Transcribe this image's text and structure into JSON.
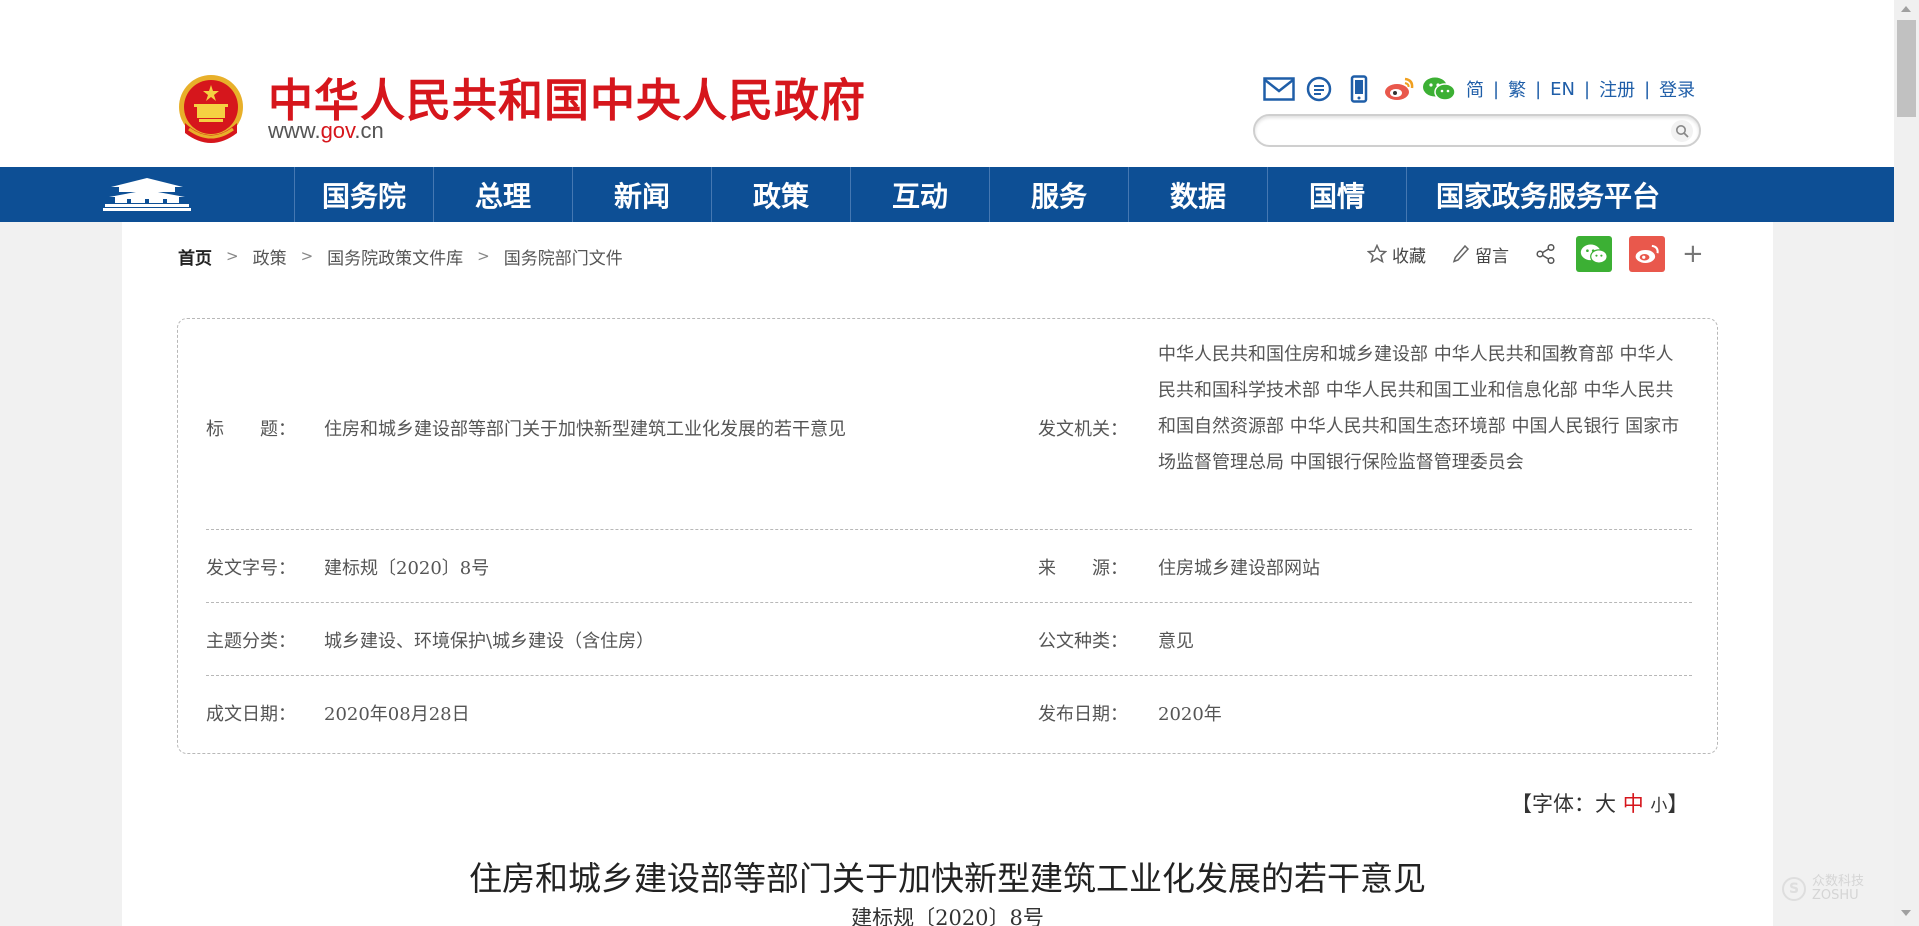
{
  "header": {
    "site_title": "中华人民共和国中央人民政府",
    "url_prefix": "www.",
    "url_brand": "gov",
    "url_suffix": ".cn",
    "tool_icons": [
      "mail-icon",
      "message-icon",
      "mobile-icon",
      "weibo-icon",
      "wechat-icon"
    ],
    "languages": [
      "简",
      "繁",
      "EN"
    ],
    "account": [
      "注册",
      "登录"
    ],
    "search_placeholder": ""
  },
  "nav": {
    "items": [
      "国务院",
      "总理",
      "新闻",
      "政策",
      "互动",
      "服务",
      "数据",
      "国情",
      "国家政务服务平台"
    ]
  },
  "breadcrumb": [
    "首页",
    "政策",
    "国务院政策文件库",
    "国务院部门文件"
  ],
  "share": {
    "favorite": "收藏",
    "comment": "留言",
    "plus": "+"
  },
  "info": {
    "title_label": "标　　题：",
    "title_value": "住房和城乡建设部等部门关于加快新型建筑工业化发展的若干意见",
    "issuer_label": "发文机关：",
    "issuer_value": "中华人民共和国住房和城乡建设部 中华人民共和国教育部 中华人民共和国科学技术部 中华人民共和国工业和信息化部 中华人民共和国自然资源部 中华人民共和国生态环境部 中国人民银行 国家市场监督管理总局 中国银行保险监督管理委员会",
    "doc_no_label": "发文字号：",
    "doc_no_value": "建标规〔2020〕8号",
    "source_label": "来　　源：",
    "source_value": "住房城乡建设部网站",
    "topic_label": "主题分类：",
    "topic_value": "城乡建设、环境保护\\城乡建设（含住房）",
    "type_label": "公文种类：",
    "type_value": "意见",
    "written_label": "成文日期：",
    "written_value": "2020年08月28日",
    "published_label": "发布日期：",
    "published_value": "2020年"
  },
  "fontsize": {
    "open": "【字体：",
    "large": "大",
    "medium": "中",
    "small": "小",
    "close": "】"
  },
  "document": {
    "title": "住房和城乡建设部等部门关于加快新型建筑工业化发展的若干意见",
    "number": "建标规〔2020〕8号"
  },
  "watermark": {
    "mark": "S",
    "line1": "众数科技",
    "line2": "ZOSHU"
  },
  "colors": {
    "brand_red": "#d6161c",
    "nav_blue": "#0d4f95",
    "link_blue": "#1f5ea8",
    "wechat_green": "#3cb034",
    "weibo_red": "#e9584c"
  }
}
